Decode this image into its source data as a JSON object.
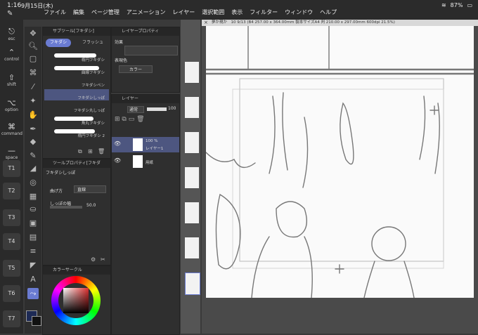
{
  "status": {
    "time": "1:16",
    "date": "9月15日(木)",
    "battery": "87%"
  },
  "menu": [
    "ファイル",
    "編集",
    "ページ管理",
    "アニメーション",
    "レイヤー",
    "選択範囲",
    "表示",
    "フィルター",
    "ウィンドウ",
    "ヘルプ"
  ],
  "modifiers": {
    "esc": "esc",
    "control": "control",
    "shift": "shift",
    "option": "option",
    "command": "command",
    "space": "space"
  },
  "tkeys": [
    "T1",
    "T2",
    "T3",
    "T4",
    "T5",
    "T6",
    "T7"
  ],
  "subtool": {
    "title": "サブツール[フキダシ]",
    "tab_active": "フキダシ",
    "tab_other": "フラッシュ",
    "brushes": [
      "楕円フキダシ",
      "曲線フキダシ",
      "フキダシペン",
      "フキダシしっぽ",
      "フキダシ丸しっぽ",
      "角丸フキダシ",
      "楕円フキダシ 2"
    ]
  },
  "toolprop": {
    "title": "ツールプロパティ[フキダ",
    "tool_name": "フキダシしっぽ",
    "bend_label": "曲げ方",
    "bend_value": "直線",
    "width_label": "しっぽの幅",
    "width_value": "50.0"
  },
  "colorpanel": {
    "title": "カラーサークル"
  },
  "layerprop": {
    "title": "レイヤープロパティ",
    "effect": "効果",
    "expression_color": "表現色",
    "color_value": "カラー"
  },
  "layers": {
    "title": "レイヤー",
    "blend_mode": "通常",
    "opacity": "100",
    "items": [
      {
        "percent": "100 %",
        "mode": "通常",
        "name": "レイヤー1"
      },
      {
        "name": "用紙"
      }
    ]
  },
  "canvas": {
    "tab_title": "夢か現か　10 9/13 (B4 257.00 x 364.00mm 製本サイズA4 判 210.00 x 297.00mm 600dpi 21.5%)"
  },
  "colors": {
    "accent": "#6a7bd1",
    "panel": "#2f2f2f",
    "header": "#262626"
  }
}
